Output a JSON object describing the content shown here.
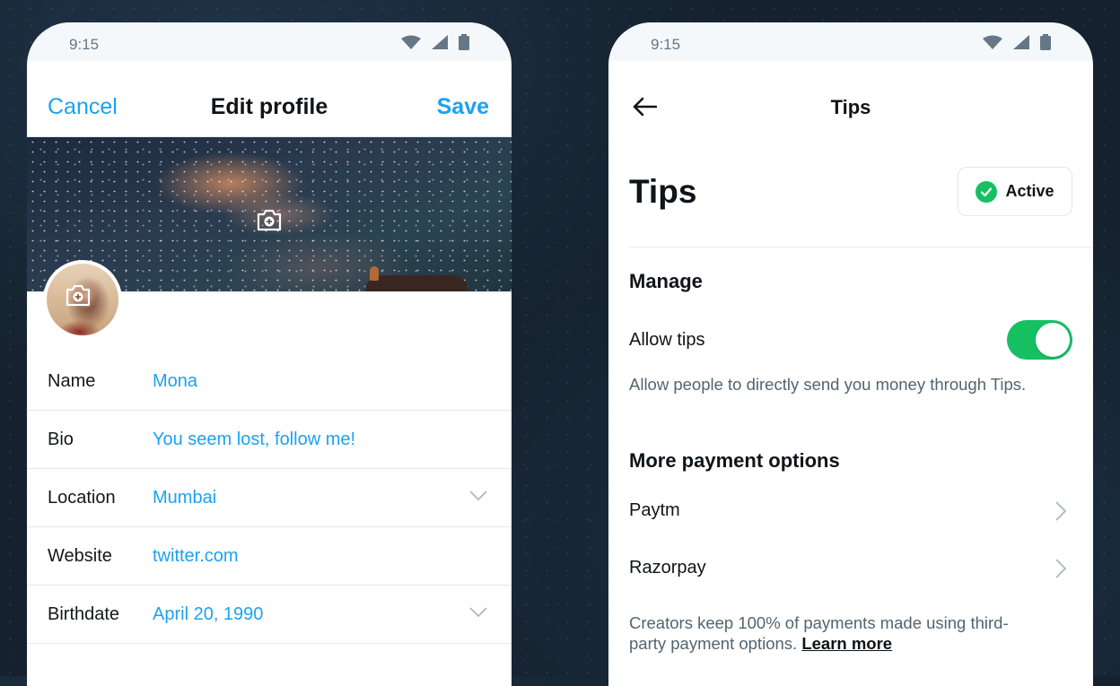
{
  "left_screen": {
    "status_bar": {
      "time": "9:15",
      "icons": [
        "wifi-icon",
        "cellular-signal-icon",
        "battery-icon"
      ]
    },
    "nav": {
      "cancel_label": "Cancel",
      "title": "Edit profile",
      "save_label": "Save"
    },
    "header_image": {
      "description": "Milky way night sky",
      "camera_icon": "add-photo-icon"
    },
    "avatar": {
      "camera_icon": "add-photo-icon"
    },
    "fields": [
      {
        "label": "Name",
        "value": "Mona",
        "has_dropdown": false
      },
      {
        "label": "Bio",
        "value": "You seem lost, follow me!",
        "has_dropdown": false
      },
      {
        "label": "Location",
        "value": "Mumbai",
        "has_dropdown": true
      },
      {
        "label": "Website",
        "value": "twitter.com",
        "has_dropdown": false
      },
      {
        "label": "Birthdate",
        "value": "April 20, 1990",
        "has_dropdown": true
      }
    ]
  },
  "right_screen": {
    "status_bar": {
      "time": "9:15",
      "icons": [
        "wifi-icon",
        "cellular-signal-icon",
        "battery-icon"
      ]
    },
    "nav": {
      "back_icon": "arrow-left-icon",
      "title": "Tips"
    },
    "heading": "Tips",
    "status_badge": {
      "label": "Active",
      "icon": "check-circle-icon"
    },
    "manage": {
      "title": "Manage",
      "allow_tips_label": "Allow tips",
      "allow_tips_enabled": true,
      "description": "Allow people to directly send you money through Tips."
    },
    "more_payment": {
      "title": "More payment options",
      "options": [
        {
          "label": "Paytm"
        },
        {
          "label": "Razorpay"
        }
      ],
      "footer_text": "Creators keep 100% of payments made using third-party payment options.",
      "learn_more_label": "Learn more"
    }
  },
  "colors": {
    "accent_blue": "#1da1f2",
    "toggle_green": "#17bf63",
    "background": "#15212e",
    "secondary_text": "#536471"
  }
}
